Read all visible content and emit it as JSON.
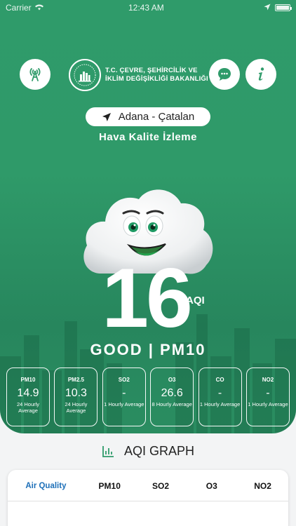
{
  "status_bar": {
    "carrier": "Carrier",
    "time": "12:43 AM"
  },
  "header": {
    "ministry_line1": "T.C. ÇEVRE, ŞEHİRCİLİK VE",
    "ministry_line2": "İKLİM DEĞİŞİKLİĞİ BAKANLIĞI"
  },
  "location": {
    "label": "Adana - Çatalan"
  },
  "subtitle": "Hava Kalite İzleme",
  "aqi": {
    "value": "16",
    "unit": "AQI",
    "status": "GOOD | PM10"
  },
  "pollutants": [
    {
      "name": "PM10",
      "value": "14.9",
      "desc": "24 Hourly Average"
    },
    {
      "name": "PM2.5",
      "value": "10.3",
      "desc": "24 Hourly Average"
    },
    {
      "name": "SO2",
      "value": "-",
      "desc": "1 Hourly Average"
    },
    {
      "name": "O3",
      "value": "26.6",
      "desc": "8 Hourly Average"
    },
    {
      "name": "CO",
      "value": "-",
      "desc": "1 Hourly Average"
    },
    {
      "name": "NO2",
      "value": "-",
      "desc": "1 Hourly Average"
    }
  ],
  "graph": {
    "title": "AQI GRAPH",
    "tabs": [
      "Air Quality",
      "PM10",
      "SO2",
      "O3",
      "NO2"
    ]
  },
  "colors": {
    "green": "#2f9b6a",
    "active_tab": "#1d6fb8"
  }
}
